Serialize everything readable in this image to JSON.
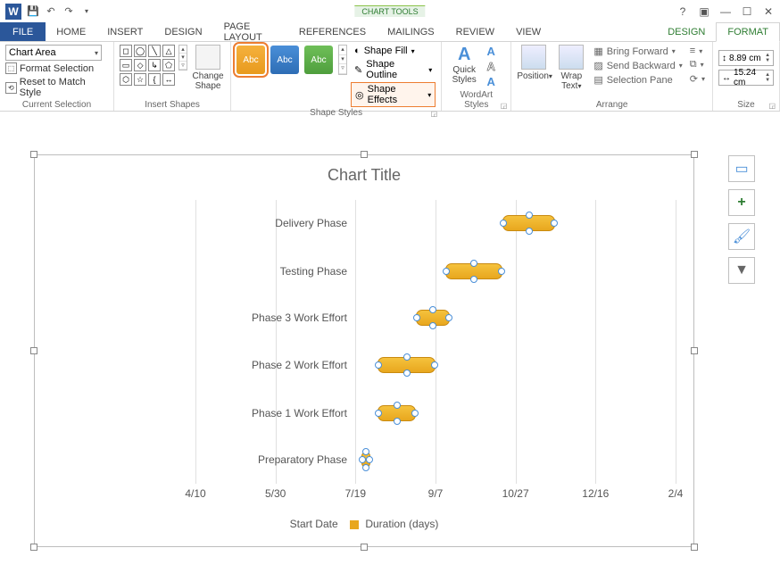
{
  "titlebar": {
    "contextual_label": "CHART TOOLS"
  },
  "tabs": {
    "file": "FILE",
    "home": "HOME",
    "insert": "INSERT",
    "design": "DESIGN",
    "pagelayout": "PAGE LAYOUT",
    "references": "REFERENCES",
    "mailings": "MAILINGS",
    "review": "REVIEW",
    "view": "VIEW",
    "ct_design": "DESIGN",
    "ct_format": "FORMAT"
  },
  "ribbon": {
    "selection": {
      "combo": "Chart Area",
      "format_selection": "Format Selection",
      "reset": "Reset to Match Style",
      "label": "Current Selection"
    },
    "insert_shapes": {
      "change_shape": "Change\nShape",
      "label": "Insert Shapes"
    },
    "shape_styles": {
      "swatch_text": "Abc",
      "fill": "Shape Fill",
      "outline": "Shape Outline",
      "effects": "Shape Effects",
      "label": "Shape Styles"
    },
    "wordart": {
      "quick": "Quick\nStyles",
      "label": "WordArt Styles"
    },
    "arrange": {
      "position": "Position",
      "wrap": "Wrap\nText",
      "bring_forward": "Bring Forward",
      "send_backward": "Send Backward",
      "selection_pane": "Selection Pane",
      "label": "Arrange"
    },
    "size": {
      "height": "8.89 cm",
      "width": "15.24 cm",
      "label": "Size"
    }
  },
  "chart_data": {
    "type": "bar",
    "title": "Chart Title",
    "categories": [
      "Delivery Phase",
      "Testing Phase",
      "Phase 3 Work Effort",
      "Phase 2 Work Effort",
      "Phase 1 Work Effort",
      "Preparatory Phase"
    ],
    "x_ticks": [
      "4/10",
      "5/30",
      "7/19",
      "9/7",
      "10/27",
      "12/16",
      "2/4"
    ],
    "legend": [
      "Start Date",
      "Duration (days)"
    ],
    "series": [
      {
        "name": "Duration (days)",
        "bars": [
          {
            "cat": "Preparatory Phase",
            "start_pct": 34.5,
            "width_pct": 2
          },
          {
            "cat": "Phase 1 Work Effort",
            "start_pct": 38,
            "width_pct": 8
          },
          {
            "cat": "Phase 2 Work Effort",
            "start_pct": 38,
            "width_pct": 12
          },
          {
            "cat": "Phase 3 Work Effort",
            "start_pct": 46,
            "width_pct": 7
          },
          {
            "cat": "Testing Phase",
            "start_pct": 52,
            "width_pct": 12
          },
          {
            "cat": "Delivery Phase",
            "start_pct": 64,
            "width_pct": 11
          }
        ]
      }
    ]
  }
}
